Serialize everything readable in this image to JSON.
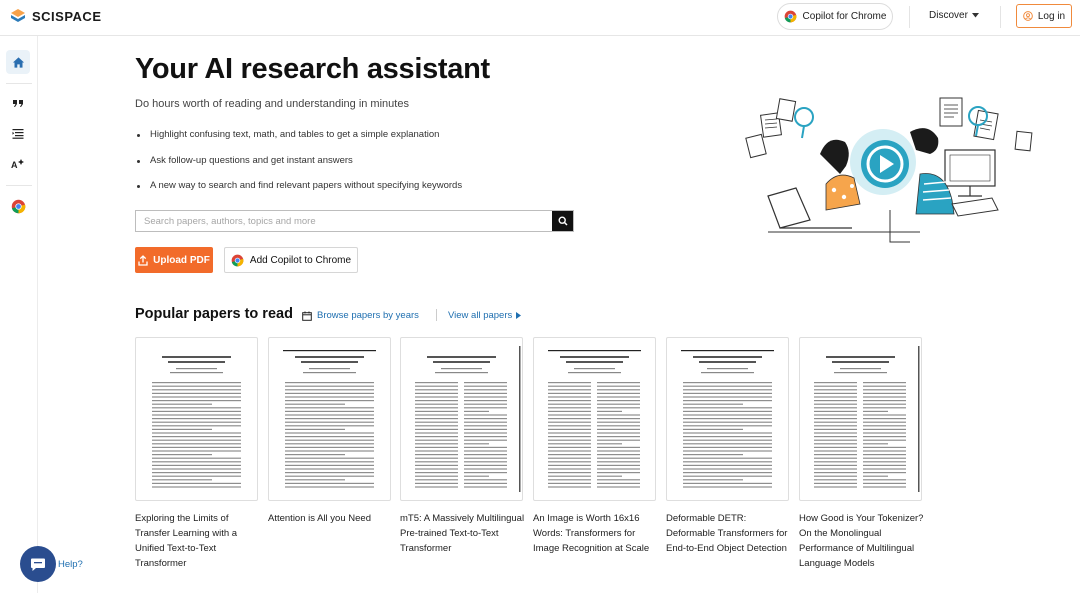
{
  "header": {
    "logo_text": "SCISPACE",
    "copilot_label": "Copilot for Chrome",
    "discover_label": "Discover",
    "login_label": "Log in"
  },
  "sidebar": {
    "items": [
      {
        "name": "home",
        "icon": "home-icon",
        "active": true
      },
      {
        "name": "citation",
        "icon": "quote-icon",
        "active": false
      },
      {
        "name": "literature-review",
        "icon": "list-icon",
        "active": false
      },
      {
        "name": "paraphraser",
        "icon": "ai-text-icon",
        "active": false
      },
      {
        "name": "chrome-extension",
        "icon": "chrome-icon",
        "active": false
      }
    ]
  },
  "hero": {
    "title": "Your AI research assistant",
    "subtitle": "Do hours worth of reading and understanding in minutes",
    "bullets": [
      "Highlight confusing text, math, and tables to get a simple explanation",
      "Ask follow-up questions and get instant answers",
      "A new way to search and find relevant papers without specifying keywords"
    ],
    "search_placeholder": "Search papers, authors, topics and more",
    "search_value": "",
    "upload_label": "Upload PDF",
    "add_copilot_label": "Add Copilot to Chrome"
  },
  "popular": {
    "title": "Popular papers to read",
    "browse_label": "Browse papers by years",
    "view_all_label": "View all papers",
    "papers": [
      {
        "title": "Exploring the Limits of Transfer Learning with a Unified Text-to-Text Transformer"
      },
      {
        "title": "Attention is All you Need"
      },
      {
        "title": "mT5: A Massively Multilingual Pre-trained Text-to-Text Transformer"
      },
      {
        "title": "An Image is Worth 16x16 Words: Transformers for Image Recognition at Scale"
      },
      {
        "title": "Deformable DETR: Deformable Transformers for End-to-End Object Detection"
      },
      {
        "title": "How Good is Your Tokenizer? On the Monolingual Performance of Multilingual Language Models"
      }
    ]
  },
  "help": {
    "label": "Help?"
  },
  "colors": {
    "accent_orange": "#f26b2a",
    "link_blue": "#1f6fb0",
    "help_blue": "#2a4d8f",
    "illustration_teal": "#2aa3c2"
  }
}
